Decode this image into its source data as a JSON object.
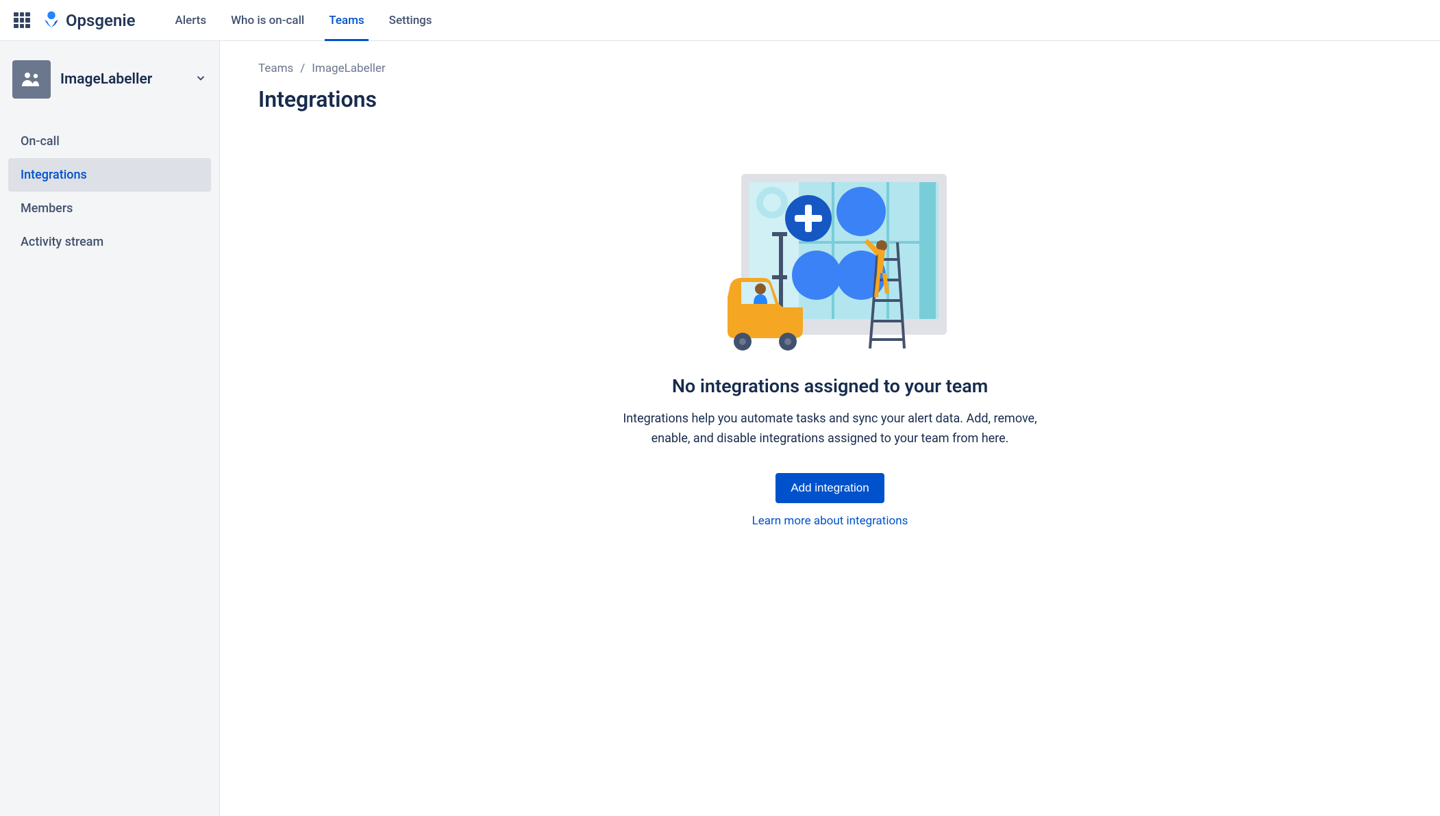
{
  "header": {
    "product_name": "Opsgenie",
    "nav": [
      {
        "label": "Alerts",
        "active": false
      },
      {
        "label": "Who is on-call",
        "active": false
      },
      {
        "label": "Teams",
        "active": true
      },
      {
        "label": "Settings",
        "active": false
      }
    ]
  },
  "sidebar": {
    "team_name": "ImageLabeller",
    "items": [
      {
        "label": "On-call",
        "active": false
      },
      {
        "label": "Integrations",
        "active": true
      },
      {
        "label": "Members",
        "active": false
      },
      {
        "label": "Activity stream",
        "active": false
      }
    ]
  },
  "breadcrumb": {
    "items": [
      "Teams",
      "ImageLabeller"
    ],
    "separator": "/"
  },
  "page": {
    "title": "Integrations"
  },
  "empty_state": {
    "title": "No integrations assigned to your team",
    "description": "Integrations help you automate tasks and sync your alert data. Add, remove, enable, and disable integrations assigned to your team from here.",
    "primary_button": "Add integration",
    "help_link": "Learn more about integrations"
  }
}
